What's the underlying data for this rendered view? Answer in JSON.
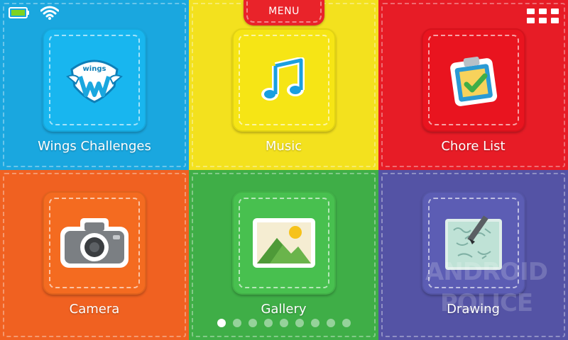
{
  "header": {
    "menu_label": "MENU"
  },
  "status": {
    "battery_icon": "battery-icon",
    "wifi_icon": "wifi-icon"
  },
  "apps": [
    {
      "label": "Wings Challenges",
      "icon": "wings-badge-icon",
      "icon_text": "wings",
      "color": "#1aa7df"
    },
    {
      "label": "Music",
      "icon": "music-note-icon",
      "color": "#f3e11e"
    },
    {
      "label": "Chore List",
      "icon": "clipboard-check-icon",
      "color": "#e71c26"
    },
    {
      "label": "Camera",
      "icon": "camera-icon",
      "color": "#f06121"
    },
    {
      "label": "Gallery",
      "icon": "gallery-image-icon",
      "color": "#3fae47"
    },
    {
      "label": "Drawing",
      "icon": "drawing-pencil-icon",
      "color": "#5453a5"
    }
  ],
  "pager": {
    "count": 9,
    "active_index": 0
  },
  "watermark": {
    "line1": "ANDROID",
    "line2": "POLICE"
  }
}
